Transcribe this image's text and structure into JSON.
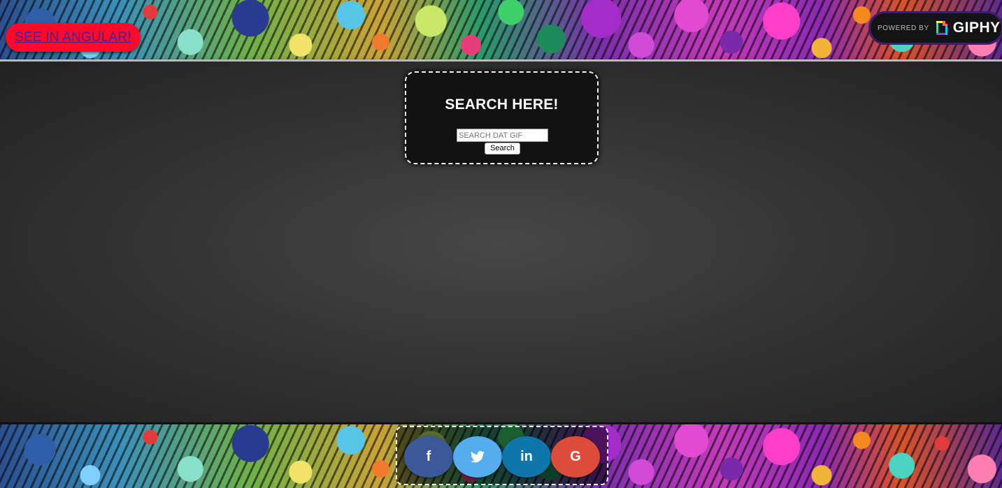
{
  "header": {
    "angular_link_label": "SEE IN ANGULAR!",
    "giphy": {
      "powered_by": "POWERED BY",
      "brand": "GIPHY"
    }
  },
  "search": {
    "title": "SEARCH HERE!",
    "input_value": "",
    "input_placeholder": "SEARCH DAT GIF",
    "button_label": "Search"
  },
  "social": {
    "buttons": [
      {
        "icon": "facebook-icon",
        "glyph": "f",
        "color": "#3b5998"
      },
      {
        "icon": "twitter-icon",
        "glyph": "🐦",
        "color": "#55acee"
      },
      {
        "icon": "linkedin-icon",
        "glyph": "in",
        "color": "#0e76a8"
      },
      {
        "icon": "google-icon",
        "glyph": "G",
        "color": "#dd4b39"
      }
    ]
  },
  "colors": {
    "angular_button": "#ff0a2a",
    "link_text": "#551a8b",
    "panel_background": "#121212",
    "dashed_border": "#f2f2f2"
  }
}
